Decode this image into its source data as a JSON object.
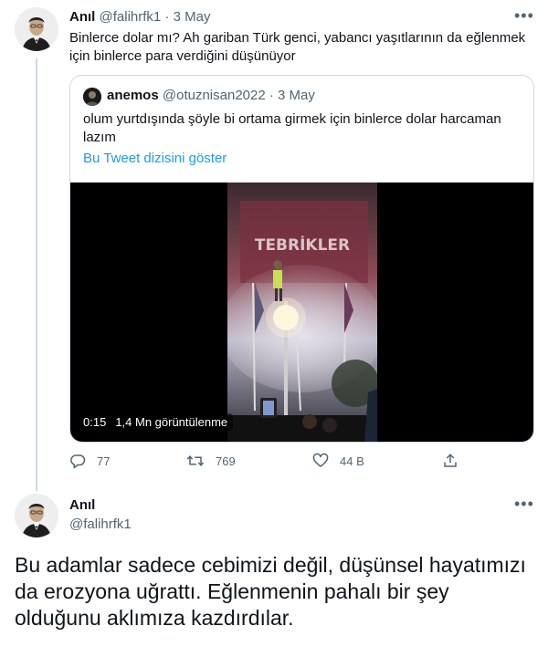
{
  "tweet1": {
    "author_name": "Anıl",
    "author_handle": "@falihrfk1",
    "separator": "·",
    "date": "3 May",
    "more": "•••",
    "text": "Binlerce dolar mı? Ah gariban Türk genci, yabancı yaşıtlarının da eğlenmek için binlerce para verdiğini düşünüyor",
    "avatar_icon": "portrait-avatar-icon"
  },
  "quote": {
    "author_name": "anemos",
    "author_handle": "@otuznisan2022",
    "separator": "·",
    "date": "3 May",
    "text": "olum yurtdışında şöyle bi ortama girmek için binlerce dolar harcaman lazım",
    "thread_link": "Bu Tweet dizisini göster",
    "video": {
      "time": "0:15",
      "views": "1,4 Mn görüntülenme",
      "banner_text": "TEBRİKLER"
    }
  },
  "actions": {
    "reply_count": "77",
    "retweet_count": "769",
    "like_count": "44 B",
    "icons": [
      "reply-icon",
      "retweet-icon",
      "like-icon",
      "share-icon"
    ]
  },
  "tweet2": {
    "author_name": "Anıl",
    "author_handle": "@falihrfk1",
    "more": "•••",
    "text": "Bu adamlar sadece cebimizi değil, düşünsel hayatımızı da erozyona uğrattı. Eğlenmenin pahalı bir şey olduğunu aklımıza kazdırdılar."
  },
  "colors": {
    "link": "#1d9bf0",
    "muted": "#536471",
    "border": "#cfd9de"
  }
}
